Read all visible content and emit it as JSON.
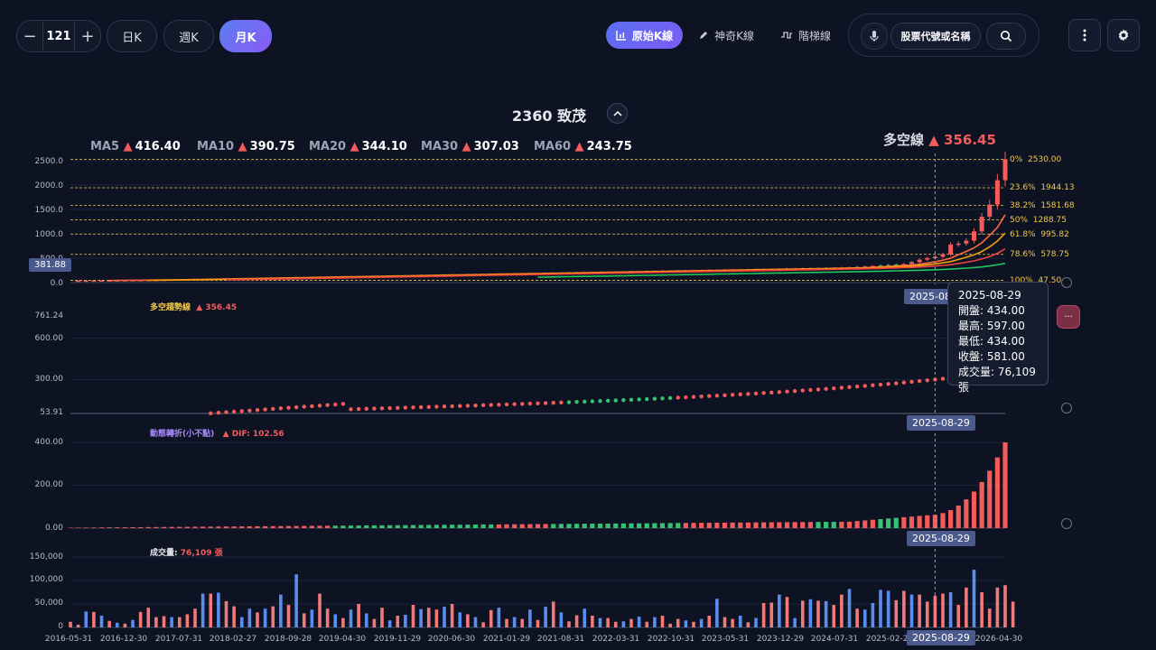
{
  "toolbar": {
    "stepper": {
      "minus": "−",
      "value": "121",
      "plus": "+"
    },
    "periods": [
      "日K",
      "週K",
      "月K"
    ],
    "modes": [
      "原始K線",
      "神奇K線",
      "階梯線"
    ],
    "search_placeholder": "股票代號或名稱",
    "colors": {
      "accent": "#6a63f0",
      "up": "#f45b5b",
      "down": "#38c172",
      "fib": "#f2c94c"
    }
  },
  "stock": {
    "title": "2360 致茂"
  },
  "ma": [
    {
      "label": "MA5",
      "arrow": "▲",
      "value": "416.40"
    },
    {
      "label": "MA10",
      "arrow": "▲",
      "value": "390.75"
    },
    {
      "label": "MA20",
      "arrow": "▲",
      "value": "344.10"
    },
    {
      "label": "MA30",
      "arrow": "▲",
      "value": "307.03"
    },
    {
      "label": "MA60",
      "arrow": "▲",
      "value": "243.75"
    }
  ],
  "bullbear": {
    "label": "多空線",
    "arrow": "▲",
    "value": "356.45"
  },
  "main_axis": {
    "ticks": [
      "2500.0",
      "2000.0",
      "1500.0",
      "1000.0",
      "500.0",
      "0.0"
    ],
    "price_tag": "381.88"
  },
  "fib": [
    {
      "pct": "0%",
      "value": "2530.00"
    },
    {
      "pct": "23.6%",
      "value": "1944.13"
    },
    {
      "pct": "38.2%",
      "value": "1581.68"
    },
    {
      "pct": "50%",
      "value": "1288.75"
    },
    {
      "pct": "61.8%",
      "value": "995.82"
    },
    {
      "pct": "78.6%",
      "value": "578.75"
    },
    {
      "pct": "100%",
      "value": "47.50"
    }
  ],
  "crosshair_date": "2025-08-29",
  "tooltip": {
    "date": "2025-08-29",
    "open": "開盤: 434.00",
    "high": "最高: 597.00",
    "low": "最低: 434.00",
    "close": "收盤: 581.00",
    "volume": "成交量: 76,109 張"
  },
  "trend_panel": {
    "label": "多空趨勢線",
    "arrow": "▲",
    "value": "356.45",
    "ticks": [
      "761.24",
      "600.00",
      "300.00",
      "53.91"
    ]
  },
  "momentum_panel": {
    "label": "動態轉折(小不點)",
    "arrow": "▲",
    "value": "DIF: 102.56",
    "ticks": [
      "400.00",
      "200.00",
      "0.00"
    ]
  },
  "volume_panel": {
    "label": "成交量:",
    "value": "76,109 張",
    "ticks": [
      "150,000",
      "100,000",
      "50,000",
      "0"
    ]
  },
  "x_labels": [
    "2016-05-31",
    "2016-12-30",
    "2017-07-31",
    "2018-02-27",
    "2018-09-28",
    "2019-04-30",
    "2019-11-29",
    "2020-06-30",
    "2021-01-29",
    "2021-08-31",
    "2022-03-31",
    "2022-10-31",
    "2023-05-31",
    "2023-12-29",
    "2024-07-31",
    "2025-02-27",
    "2025-08-29",
    "2026-04-30"
  ],
  "chart_data": {
    "type": "bar",
    "title": "2360 致茂",
    "months": 121,
    "start_month": "2016-05",
    "volume_ylim": [
      0,
      150000
    ],
    "volume_values": [
      12000,
      6000,
      34000,
      33000,
      25000,
      14000,
      10000,
      8000,
      16000,
      33000,
      42000,
      22000,
      24000,
      22000,
      22000,
      28000,
      40000,
      72000,
      72000,
      74000,
      56000,
      45000,
      22000,
      40000,
      32000,
      40000,
      45000,
      70000,
      48000,
      113000,
      30000,
      38000,
      72000,
      40000,
      28000,
      20000,
      38000,
      50000,
      30000,
      18000,
      42000,
      15000,
      25000,
      27000,
      48000,
      39000,
      42000,
      38000,
      44000,
      50000,
      32000,
      28000,
      22000,
      11000,
      37000,
      42000,
      18000,
      22000,
      18000,
      38000,
      16000,
      44000,
      55000,
      32000,
      13000,
      26000,
      40000,
      25000,
      20000,
      20000,
      12000,
      13000,
      18000,
      23000,
      12000,
      22000,
      25000,
      8000,
      18000,
      15000,
      12000,
      18000,
      25000,
      61000,
      22000,
      18000,
      25000,
      11000,
      20000,
      52000,
      53000,
      70000,
      65000,
      20000,
      57000,
      60000,
      57000,
      56000,
      48000,
      70000,
      82000,
      40000,
      38000,
      52000,
      80000,
      78000,
      58000,
      78000,
      70000,
      70000,
      55000,
      68000,
      72000,
      75000,
      48000,
      85000,
      123000,
      75000,
      40000,
      85000,
      90000,
      55000
    ],
    "momentum_ylim": [
      0,
      400
    ],
    "trend_ylim": [
      53.91,
      761.24
    ],
    "trend_start": 55,
    "trend_end": 356.45,
    "main_ylim": [
      0,
      2600
    ],
    "closes_last": [
      380,
      420,
      470,
      500,
      530,
      581,
      780,
      800,
      860,
      1050,
      1350,
      1600,
      2100,
      2530
    ]
  }
}
